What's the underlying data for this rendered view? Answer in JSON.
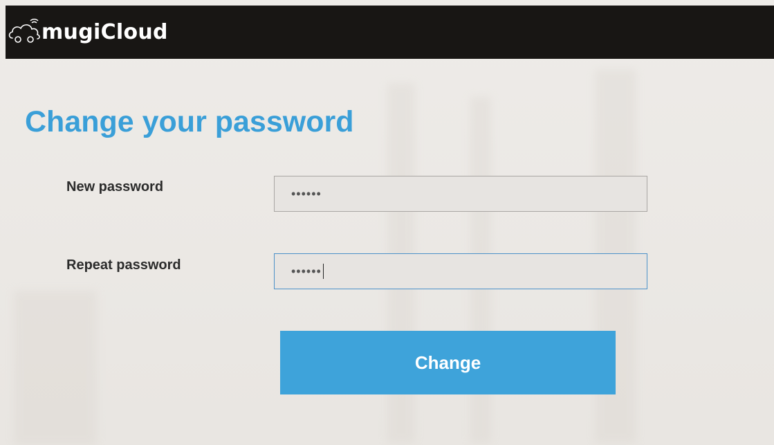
{
  "header": {
    "brand": "mugiCloud",
    "logo_icon": "cloud-car-icon",
    "background": "#181614"
  },
  "main": {
    "title": "Change your password",
    "accent_color": "#3a9fd8"
  },
  "form": {
    "new_password": {
      "label": "New password",
      "value": "••••••"
    },
    "repeat_password": {
      "label": "Repeat password",
      "value": "••••••"
    },
    "submit_label": "Change",
    "button_color": "#3ea3da"
  }
}
